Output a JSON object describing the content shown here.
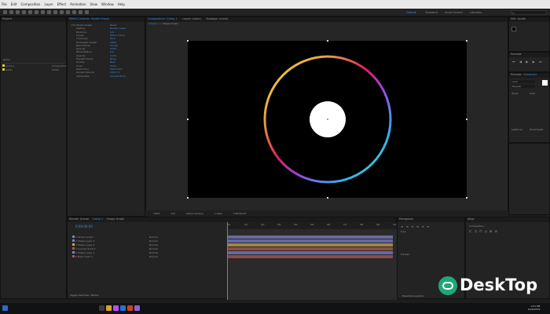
{
  "menu": [
    "File",
    "Edit",
    "Composition",
    "Layer",
    "Effect",
    "Animation",
    "View",
    "Window",
    "Help"
  ],
  "workspaces": [
    "Default",
    "Standard",
    "Small Screen",
    "Libraries"
  ],
  "project_tab": "Project",
  "effect_controls_tab": "Effect Controls: Stroke Graph",
  "composition_tab": "Composition: Comp 1",
  "layer_tab": "Layer: (none)",
  "footage_tab": "Footage: (none)",
  "comp_subtab": "Comp 1",
  "shape_subtab": "Shape Graph",
  "project_items": [
    {
      "name": "Comp 1",
      "type": "Composition",
      "color": "#d6cf3c"
    },
    {
      "name": "Solids",
      "type": "Folder",
      "color": "#d6cf3c"
    }
  ],
  "effect_rows": [
    {
      "label": "Stroke Graph",
      "value": "Reset"
    },
    {
      "label": "Setting",
      "value": "Radial, Linear"
    },
    {
      "label": "Distance",
      "value": "0.0"
    },
    {
      "label": "Center",
      "value": "960.0, 540.0"
    },
    {
      "label": "Thickness",
      "value": "50.0"
    },
    {
      "label": "Processed Length",
      "value": "100%"
    },
    {
      "label": "Blend Mode",
      "value": "Screen"
    },
    {
      "label": "Opacity",
      "value": "100%"
    },
    {
      "label": "Blend Radius",
      "value": "0.0"
    },
    {
      "label": "Opacity",
      "value": "100%"
    },
    {
      "label": "Transfer Mode",
      "value": "None"
    },
    {
      "label": "Quality",
      "value": "Best"
    },
    {
      "label": "Color",
      "value": "Color"
    },
    {
      "label": "Start Color",
      "value": "Start Color"
    },
    {
      "label": "Render Bounds",
      "value": "100.0 %"
    },
    {
      "label": "Interpolate",
      "value": "Smooth Ends"
    }
  ],
  "viewer_footer": [
    "100%",
    "Full",
    "Active Camera",
    "1 View",
    "0:00:00:00"
  ],
  "timeline": {
    "tabs": [
      "Render Queue",
      "Comp 1",
      "Shape Graph"
    ],
    "timecode": "0:00:00:00",
    "layers": [
      {
        "num": "1",
        "name": "Stroke Graph",
        "mode": "Normal",
        "color": "#7e7ecb"
      },
      {
        "num": "2",
        "name": "Shape Layer 3",
        "mode": "Normal",
        "color": "#7e7ecb"
      },
      {
        "num": "3",
        "name": "Shape Layer 2",
        "mode": "Normal",
        "color": "#c9a84a"
      },
      {
        "num": "4",
        "name": "Colored Solid 1",
        "mode": "Normal",
        "color": "#b05555"
      },
      {
        "num": "5",
        "name": "Shape Layer 1",
        "mode": "Normal",
        "color": "#7e7ecb"
      },
      {
        "num": "6",
        "name": "Black Solid 1",
        "mode": "Normal",
        "color": "#b05555"
      }
    ],
    "ruler": [
      "0s",
      "01s",
      "02s",
      "03s",
      "04s",
      "05s",
      "06s",
      "07s",
      "08s",
      "09s",
      "10s"
    ],
    "status": "Toggle Switches / Modes"
  },
  "right_panels": {
    "info_tab": "Info",
    "audio_tab": "Audio",
    "preview_tab": "Preview",
    "character_tab": "Character",
    "paragraph_tab": "Paragraph",
    "align_tab": "Align",
    "tracker_tab": "Tracker",
    "font_name": "Arial",
    "font_style": "Regular",
    "font_size": "36 px",
    "leading": "Auto",
    "color_labels": [
      "Ligatures",
      "Hindi Digits"
    ],
    "align_to": "Composition",
    "paragraph_values": [
      "0 px",
      "0 px",
      "0 px"
    ],
    "essential": "Essential Graphics"
  },
  "watermark": {
    "text": "DeskTop",
    "color": "#ffffff"
  },
  "taskbar": {
    "time": "1:01 PM",
    "date": "6/28/2019"
  }
}
